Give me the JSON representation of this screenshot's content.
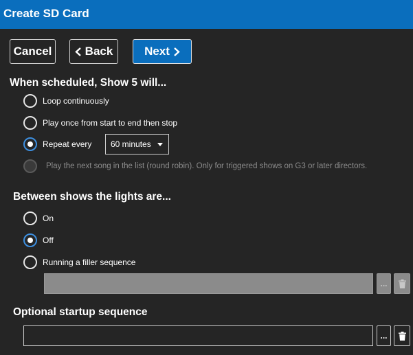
{
  "window": {
    "title": "Create SD Card"
  },
  "toolbar": {
    "cancel_label": "Cancel",
    "back_label": "Back",
    "next_label": "Next"
  },
  "schedule": {
    "heading": "When scheduled, Show 5 will...",
    "options": [
      {
        "label": "Loop continuously",
        "checked": false,
        "disabled": false
      },
      {
        "label": "Play once from start to end then stop",
        "checked": false,
        "disabled": false
      },
      {
        "label": "Repeat every",
        "checked": true,
        "disabled": false
      },
      {
        "label": "Play the next song in the list (round robin). Only for triggered shows on G3 or later directors.",
        "checked": false,
        "disabled": true
      }
    ],
    "repeat_interval": "60 minutes"
  },
  "between": {
    "heading": "Between shows the lights are...",
    "options": [
      {
        "label": "On",
        "checked": false
      },
      {
        "label": "Off",
        "checked": true
      },
      {
        "label": "Running a filler sequence",
        "checked": false
      }
    ],
    "filler_value": "",
    "browse_label": "..."
  },
  "startup": {
    "heading": "Optional startup sequence",
    "value": "",
    "browse_label": "..."
  },
  "colors": {
    "accent": "#0a6ebd",
    "background": "#252525",
    "radio_checked": "#3d8fe0"
  }
}
